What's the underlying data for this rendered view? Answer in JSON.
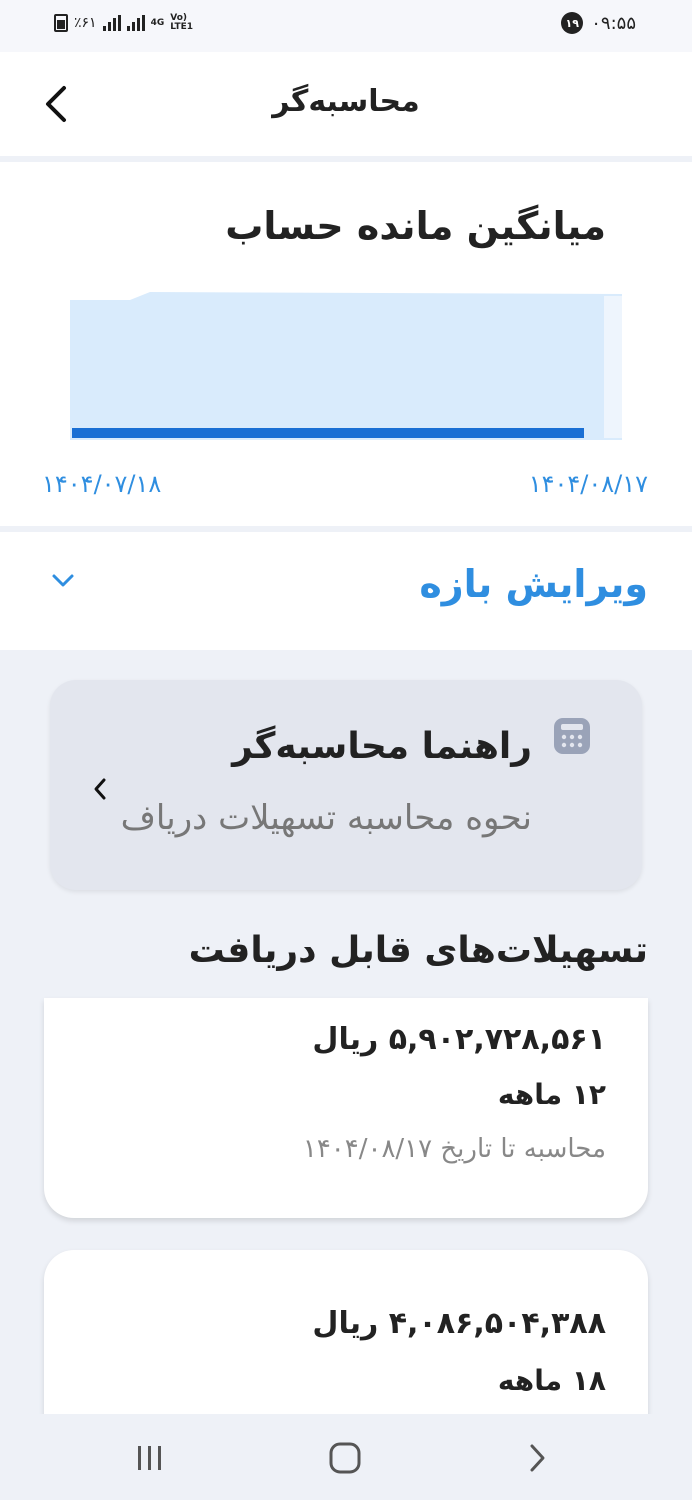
{
  "status_bar": {
    "battery_text": "٪۶۱",
    "network_top": "4G",
    "network_bottom": "LTE1",
    "volte": "Vo)",
    "notification_count": "۱۹",
    "time": "۰۹:۵۵"
  },
  "header": {
    "title": "محاسبه‌گر"
  },
  "chart": {
    "title": "میانگین مانده حساب",
    "start_date": "۱۴۰۴/۰۷/۱۸",
    "end_date": "۱۴۰۴/۰۸/۱۷",
    "colors": {
      "area": "#d9ebfc",
      "line": "#1a6fd4",
      "date": "#2f8ee0"
    }
  },
  "chart_data": {
    "type": "area",
    "x": [
      "۱۴۰۴/۰۷/۱۸",
      "۱۴۰۴/۰۸/۱۷"
    ],
    "values": [
      0,
      0
    ],
    "title": "میانگین مانده حساب",
    "grid": false
  },
  "edit_range": {
    "label": "ویرایش بازه"
  },
  "guide": {
    "title": "راهنما محاسبه‌گر",
    "subtitle": "نحوه محاسبه تسهیلات دریاف"
  },
  "loans_section": {
    "title": "تسهیلات‌های قابل دریافت",
    "items": [
      {
        "amount": "۵,۹۰۲,۷۲۸,۵۶۱ ریال",
        "duration": "۱۲ ماهه",
        "calc_date": "محاسبه تا تاریخ ۱۴۰۴/۰۸/۱۷"
      },
      {
        "amount": "۴,۰۸۶,۵۰۴,۳۸۸ ریال",
        "duration": "۱۸ ماهه"
      }
    ]
  }
}
